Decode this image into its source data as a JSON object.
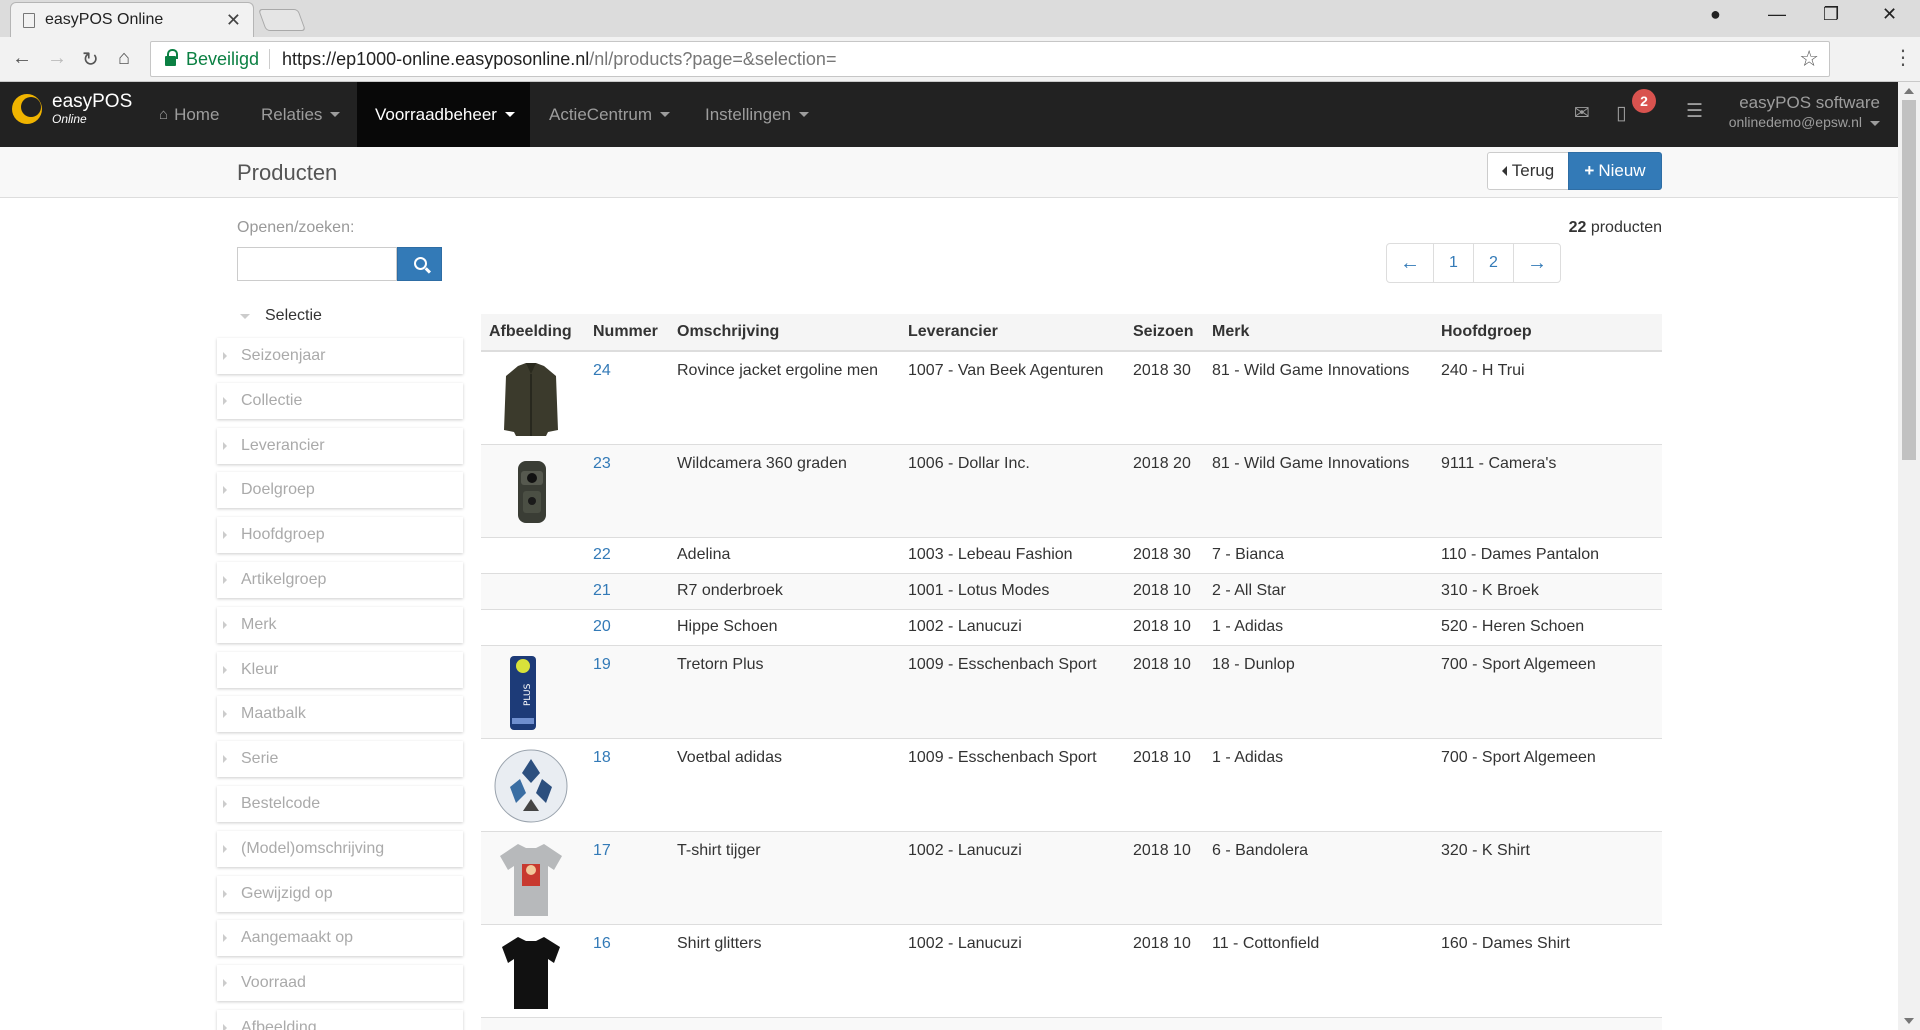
{
  "browser": {
    "tab_title": "easyPOS Online",
    "secure_label": "Beveiligd",
    "url_host": "https://ep1000-online.easyposonline.nl",
    "url_path": "/nl/products?page=&selection="
  },
  "nav": {
    "brand_name": "easyPOS",
    "brand_sub": "Online",
    "home": "Home",
    "relaties": "Relaties",
    "voorraadbeheer": "Voorraadbeheer",
    "actiecentrum": "ActieCentrum",
    "instellingen": "Instellingen",
    "notification_count": "2",
    "user_company": "easyPOS software",
    "user_email": "onlinedemo@epsw.nl"
  },
  "page": {
    "title": "Producten",
    "back_label": "Terug",
    "new_label": "Nieuw"
  },
  "sidebar": {
    "search_label": "Openen/zoeken:",
    "search_value": "",
    "selection_title": "Selectie",
    "filters": [
      "Seizoenjaar",
      "Collectie",
      "Leverancier",
      "Doelgroep",
      "Hoofdgroep",
      "Artikelgroep",
      "Merk",
      "Kleur",
      "Maatbalk",
      "Serie",
      "Bestelcode",
      "(Model)omschrijving",
      "Gewijzigd op",
      "Aangemaakt op",
      "Voorraad",
      "Afbeelding"
    ]
  },
  "main": {
    "count": "22",
    "count_label": "producten",
    "pager": {
      "prev": "←",
      "p1": "1",
      "p2": "2",
      "next": "→"
    },
    "columns": [
      "Afbeelding",
      "Nummer",
      "Omschrijving",
      "Leverancier",
      "Seizoen",
      "Merk",
      "Hoofdgroep"
    ],
    "rows": [
      {
        "image": "jacket",
        "nummer": "24",
        "omschrijving": "Rovince jacket ergoline men",
        "leverancier": "1007 - Van Beek Agenturen",
        "seizoen": "2018 30",
        "merk": "81 - Wild Game Innovations",
        "hoofdgroep": "240 - H Trui"
      },
      {
        "image": "camera",
        "nummer": "23",
        "omschrijving": "Wildcamera 360 graden",
        "leverancier": "1006 - Dollar Inc.",
        "seizoen": "2018 20",
        "merk": "81 - Wild Game Innovations",
        "hoofdgroep": "9111 - Camera's"
      },
      {
        "image": "",
        "nummer": "22",
        "omschrijving": "Adelina",
        "leverancier": "1003 - Lebeau Fashion",
        "seizoen": "2018 30",
        "merk": "7 - Bianca",
        "hoofdgroep": "110 - Dames Pantalon"
      },
      {
        "image": "",
        "nummer": "21",
        "omschrijving": "R7 onderbroek",
        "leverancier": "1001 - Lotus Modes",
        "seizoen": "2018 10",
        "merk": "2 - All Star",
        "hoofdgroep": "310 - K Broek"
      },
      {
        "image": "",
        "nummer": "20",
        "omschrijving": "Hippe Schoen",
        "leverancier": "1002 - Lanucuzi",
        "seizoen": "2018 10",
        "merk": "1 - Adidas",
        "hoofdgroep": "520 - Heren Schoen"
      },
      {
        "image": "balls-tube",
        "nummer": "19",
        "omschrijving": "Tretorn Plus",
        "leverancier": "1009 - Esschenbach Sport",
        "seizoen": "2018 10",
        "merk": "18 - Dunlop",
        "hoofdgroep": "700 - Sport Algemeen"
      },
      {
        "image": "football",
        "nummer": "18",
        "omschrijving": "Voetbal adidas",
        "leverancier": "1009 - Esschenbach Sport",
        "seizoen": "2018 10",
        "merk": "1 - Adidas",
        "hoofdgroep": "700 - Sport Algemeen"
      },
      {
        "image": "tshirt-grey",
        "nummer": "17",
        "omschrijving": "T-shirt tijger",
        "leverancier": "1002 - Lanucuzi",
        "seizoen": "2018 10",
        "merk": "6 - Bandolera",
        "hoofdgroep": "320 - K Shirt"
      },
      {
        "image": "tshirt-black",
        "nummer": "16",
        "omschrijving": "Shirt glitters",
        "leverancier": "1002 - Lanucuzi",
        "seizoen": "2018 10",
        "merk": "11 - Cottonfield",
        "hoofdgroep": "160 - Dames Shirt"
      }
    ]
  },
  "colors": {
    "accent": "#337ab7",
    "navbar": "#222222",
    "badge": "#d9534f",
    "brand": "#f0b400"
  }
}
